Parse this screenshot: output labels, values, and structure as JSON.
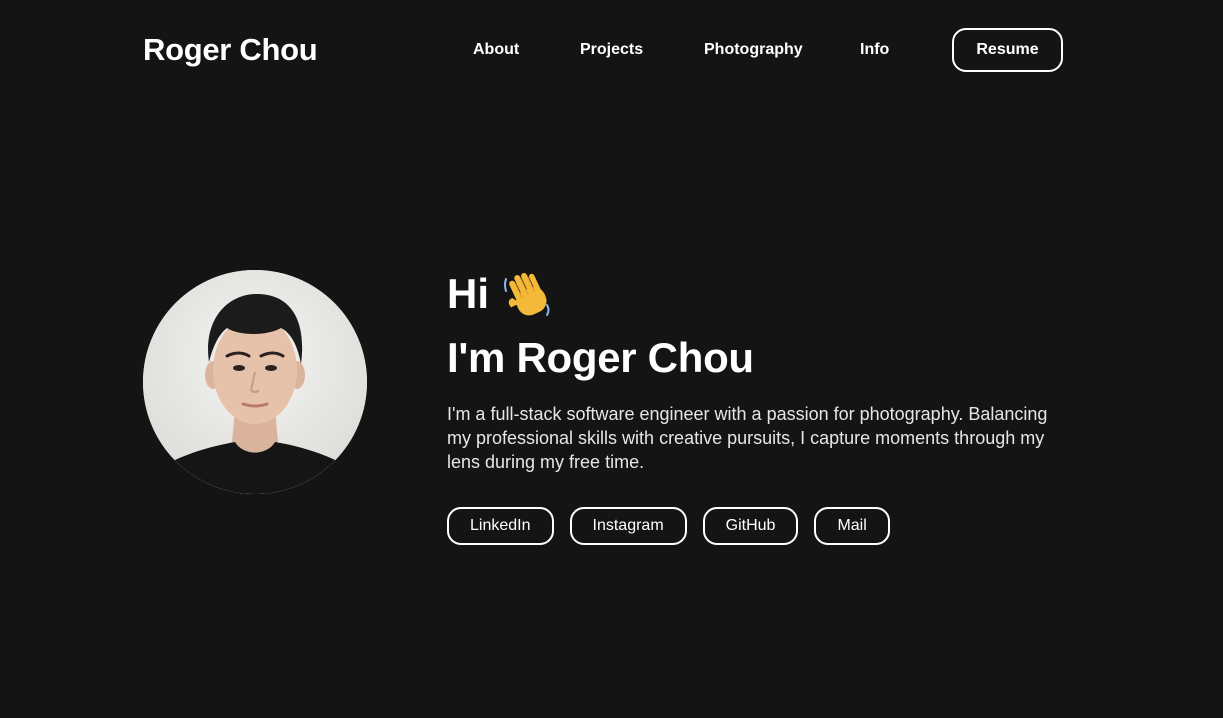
{
  "header": {
    "brand": "Roger Chou",
    "nav": [
      {
        "label": "About"
      },
      {
        "label": "Projects"
      },
      {
        "label": "Photography"
      },
      {
        "label": "Info"
      }
    ],
    "resume_label": "Resume"
  },
  "hero": {
    "greeting": "Hi",
    "greeting_icon": "waving-hand-icon",
    "headline": "I'm Roger Chou",
    "bio": "I'm a full-stack software engineer with a passion for photography. Balancing my professional skills with creative pursuits, I capture moments through my lens during my free time.",
    "socials": [
      {
        "label": "LinkedIn"
      },
      {
        "label": "Instagram"
      },
      {
        "label": "GitHub"
      },
      {
        "label": "Mail"
      }
    ]
  },
  "colors": {
    "background": "#141414",
    "text": "#ffffff",
    "muted_text": "#e6e6e6",
    "border": "#ffffff"
  }
}
